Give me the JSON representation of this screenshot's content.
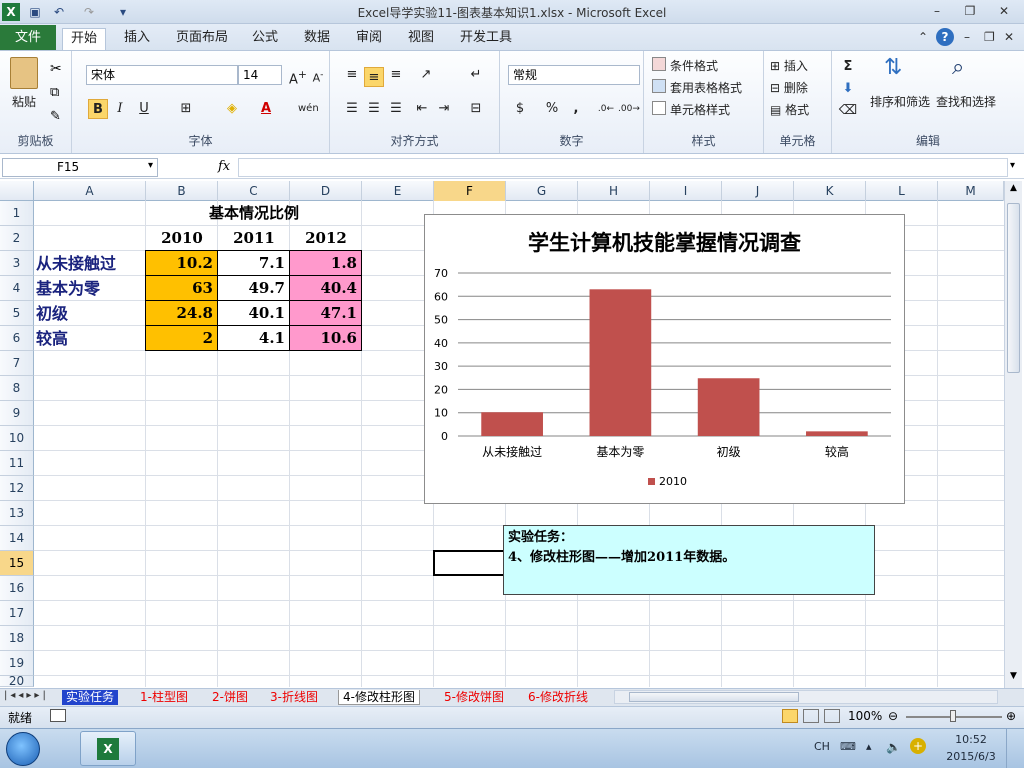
{
  "window": {
    "title": "Excel导学实验11-图表基本知识1.xlsx - Microsoft Excel"
  },
  "menu": {
    "file": "文件",
    "tabs": [
      "开始",
      "插入",
      "页面布局",
      "公式",
      "数据",
      "审阅",
      "视图",
      "开发工具"
    ]
  },
  "ribbon": {
    "clipboard": {
      "paste": "粘贴",
      "label": "剪贴板"
    },
    "font": {
      "name": "宋体",
      "size": "14",
      "label": "字体"
    },
    "align": {
      "label": "对齐方式"
    },
    "number": {
      "format": "常规",
      "percent": "%",
      "comma": ",",
      "label": "数字"
    },
    "styles": {
      "conditional": "条件格式",
      "table": "套用表格格式",
      "cell": "单元格样式",
      "label": "样式"
    },
    "cells": {
      "insert": "插入",
      "delete": "删除",
      "format": "格式",
      "label": "单元格"
    },
    "editing": {
      "sort": "排序和筛选",
      "find": "查找和选择",
      "label": "编辑"
    }
  },
  "formula_bar": {
    "name_box": "F15",
    "fx": "fx",
    "formula": ""
  },
  "columns": [
    "A",
    "B",
    "C",
    "D",
    "E",
    "F",
    "G",
    "H",
    "I",
    "J",
    "K",
    "L",
    "M"
  ],
  "rows": [
    "1",
    "2",
    "3",
    "4",
    "5",
    "6",
    "7",
    "8",
    "9",
    "10",
    "11",
    "12",
    "13",
    "14",
    "15",
    "16",
    "17",
    "18",
    "19",
    "20"
  ],
  "sheet": {
    "title": "基本情况比例",
    "years": [
      "2010",
      "2011",
      "2012"
    ],
    "labels": [
      "从未接触过",
      "基本为零",
      "初级",
      "较高"
    ],
    "values2010": [
      "10.2",
      "63",
      "24.8",
      "2"
    ],
    "values2011": [
      "7.1",
      "49.7",
      "40.1",
      "4.1"
    ],
    "values2012": [
      "1.8",
      "40.4",
      "47.1",
      "10.6"
    ]
  },
  "chart_data": {
    "type": "bar",
    "title": "学生计算机技能掌握情况调查",
    "categories": [
      "从未接触过",
      "基本为零",
      "初级",
      "较高"
    ],
    "series": [
      {
        "name": "2010",
        "values": [
          10.2,
          63,
          24.8,
          2
        ],
        "color": "#c0504d"
      }
    ],
    "yticks": [
      "0",
      "10",
      "20",
      "30",
      "40",
      "50",
      "60",
      "70"
    ],
    "ylim": [
      0,
      70
    ],
    "legend": "bottom",
    "grid": true
  },
  "note": {
    "heading": "实验任务：",
    "text": "4、修改柱形图——增加2011年数据。"
  },
  "sheet_tabs": [
    "实验任务",
    "1-柱型图",
    "2-饼图",
    "3-折线图",
    "4-修改柱形图",
    "5-修改饼图",
    "6-修改折线"
  ],
  "status": {
    "ready": "就绪",
    "zoom": "100%"
  },
  "taskbar": {
    "ime": "CH",
    "time": "10:52",
    "date": "2015/6/3"
  },
  "colors": {
    "excel_green": "#2a7a3a",
    "bar": "#c0504d",
    "yellow_fill": "#ffc000",
    "pink_fill": "#ff99cc",
    "label_blue": "#1a237e"
  }
}
